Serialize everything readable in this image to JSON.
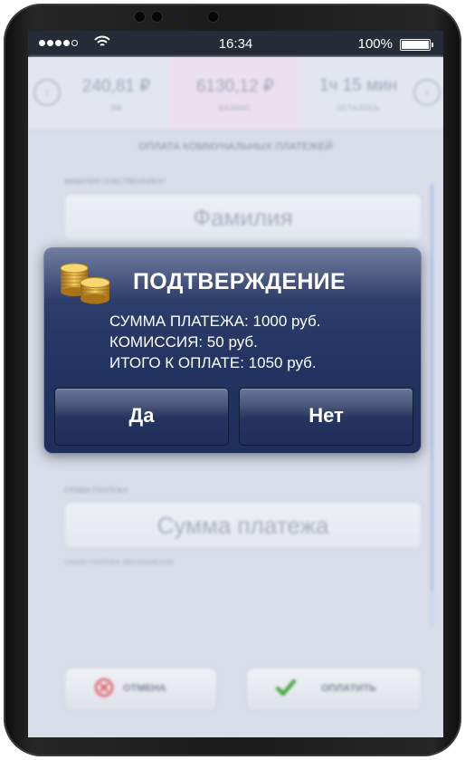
{
  "status_bar": {
    "time": "16:34",
    "battery_percent": "100%"
  },
  "info_bar": {
    "cells": [
      {
        "value": "240,81 ₽",
        "caption": "ЗМ"
      },
      {
        "value": "6130,12 ₽",
        "caption": "БАЛАНС"
      },
      {
        "value": "1ч 15 мин",
        "caption": "ОСТАЛОСЬ"
      }
    ]
  },
  "form": {
    "title": "ОПЛАТА КОММУНАЛЬНЫХ ПЛАТЕЖЕЙ",
    "surname_label": "ФАМИЛИЯ СОБСТВЕННИКА*",
    "surname_placeholder": "Фамилия",
    "amount_label": "СУММА ПЛАТЕЖА",
    "amount_placeholder": "Сумма платежа",
    "amount_hint": "СУММА ПЛАТЕЖА, БЕЗ КОМИССИИ"
  },
  "actions": {
    "cancel_label": "ОТМЕНА",
    "pay_label": "ОПЛАТИТЬ"
  },
  "dialog": {
    "title": "ПОДТВЕРЖДЕНИЕ",
    "lines": [
      "СУММА ПЛАТЕЖА: 1000 руб.",
      "КОМИССИЯ: 50 руб.",
      "ИТОГО К ОПЛАТЕ: 1050 руб."
    ],
    "yes_label": "Да",
    "no_label": "Нет"
  },
  "colors": {
    "dialog_bg": "#243563",
    "cancel_icon": "#e05a63",
    "pay_icon": "#3aa135"
  },
  "icons": {
    "cancel": "cancel-icon",
    "pay": "checkmark-icon",
    "coins": "coins-icon"
  }
}
